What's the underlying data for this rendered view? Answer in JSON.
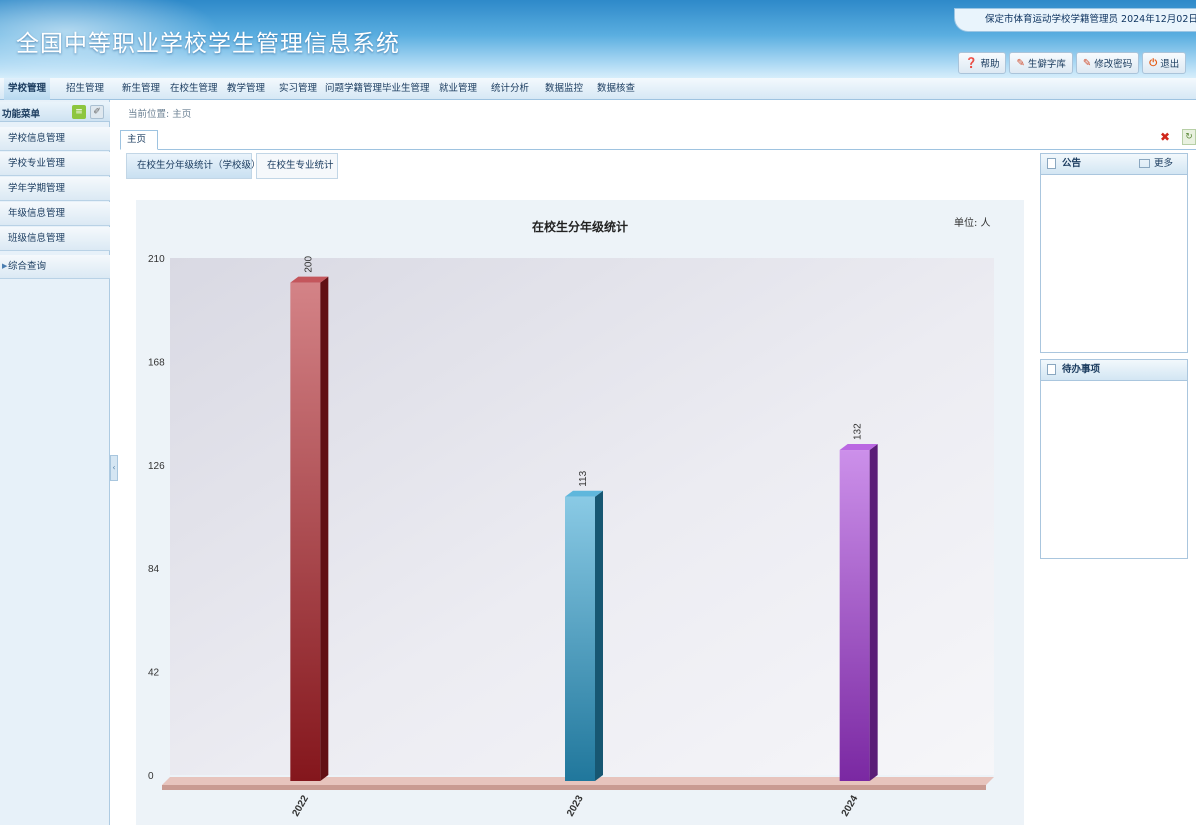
{
  "header": {
    "title": "全国中等职业学校学生管理信息系统",
    "user_info": "保定市体育运动学校学籍管理员  2024年12月02日",
    "buttons": [
      {
        "label": "帮助",
        "icon": "help-icon"
      },
      {
        "label": "生僻字库",
        "icon": "pen-icon"
      },
      {
        "label": "修改密码",
        "icon": "key-icon"
      },
      {
        "label": "退出",
        "icon": "power-icon"
      }
    ]
  },
  "nav": {
    "items": [
      "学校管理",
      "招生管理",
      "新生管理",
      "在校生管理",
      "教学管理",
      "实习管理",
      "问题学籍管理",
      "毕业生管理",
      "就业管理",
      "统计分析",
      "数据监控",
      "数据核查"
    ]
  },
  "sidebar": {
    "title": "功能菜单",
    "items": [
      "学校信息管理",
      "学校专业管理",
      "学年学期管理",
      "年级信息管理",
      "班级信息管理",
      "综合查询"
    ]
  },
  "breadcrumb": "当前位置: 主页",
  "tabs": {
    "main": "主页"
  },
  "subtabs": [
    "在校生分年级统计（学校级）",
    "在校生专业统计"
  ],
  "chart": {
    "title": "在校生分年级统计",
    "unit": "单位: 人"
  },
  "panels": {
    "notice": "公告",
    "more": "更多",
    "todo": "待办事项"
  },
  "colors": {
    "bar_2022": "#b01d25",
    "bar_2023": "#2a9fd0",
    "bar_2024": "#a335d8"
  },
  "chart_data": {
    "type": "bar",
    "title": "在校生分年级统计",
    "categories": [
      "2022",
      "2023",
      "2024"
    ],
    "values": [
      200,
      113,
      132
    ],
    "ylim": [
      0,
      210
    ],
    "yticks": [
      0,
      42,
      84,
      126,
      168,
      210
    ],
    "unit": "单位: 人",
    "grid": false,
    "style": "3d"
  }
}
